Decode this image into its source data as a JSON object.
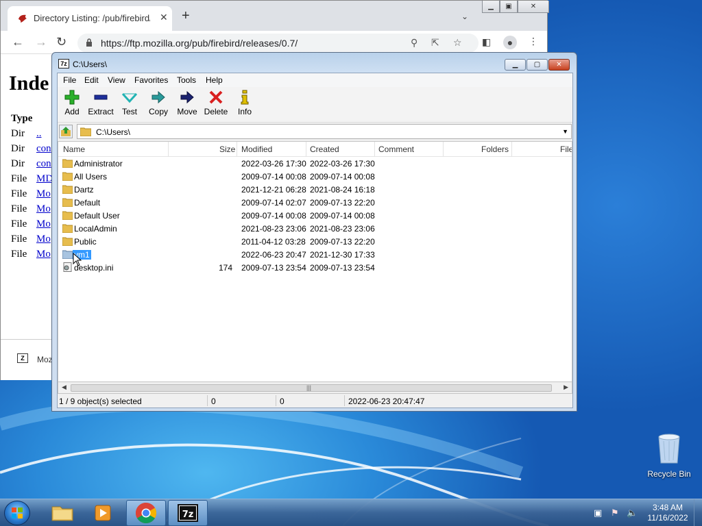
{
  "chrome": {
    "tab_title": "Directory Listing: /pub/firebird/re",
    "url": "https://ftp.mozilla.org/pub/firebird/releases/0.7/",
    "page_heading": "Inde",
    "type_header": "Type",
    "rows": [
      {
        "type": "Dir",
        "link": ".."
      },
      {
        "type": "Dir",
        "link": "con"
      },
      {
        "type": "Dir",
        "link": "con"
      },
      {
        "type": "File",
        "link": "MD"
      },
      {
        "type": "File",
        "link": "Mo"
      },
      {
        "type": "File",
        "link": "Mo"
      },
      {
        "type": "File",
        "link": "Mo"
      },
      {
        "type": "File",
        "link": "Mo"
      },
      {
        "type": "File",
        "link": "Mo"
      }
    ],
    "footer_text": "Moz"
  },
  "sevenzip": {
    "title": "C:\\Users\\",
    "menu": [
      "File",
      "Edit",
      "View",
      "Favorites",
      "Tools",
      "Help"
    ],
    "tools": [
      "Add",
      "Extract",
      "Test",
      "Copy",
      "Move",
      "Delete",
      "Info"
    ],
    "address": "C:\\Users\\",
    "columns": [
      "Name",
      "Size",
      "Modified",
      "Created",
      "Comment",
      "Folders",
      "File"
    ],
    "files": [
      {
        "name": "Administrator",
        "size": "",
        "modified": "2022-03-26 17:30",
        "created": "2022-03-26 17:30",
        "kind": "folder"
      },
      {
        "name": "All Users",
        "size": "",
        "modified": "2009-07-14 00:08",
        "created": "2009-07-14 00:08",
        "kind": "folder"
      },
      {
        "name": "Dartz",
        "size": "",
        "modified": "2021-12-21 06:28",
        "created": "2021-08-24 16:18",
        "kind": "folder"
      },
      {
        "name": "Default",
        "size": "",
        "modified": "2009-07-14 02:07",
        "created": "2009-07-13 22:20",
        "kind": "folder"
      },
      {
        "name": "Default User",
        "size": "",
        "modified": "2009-07-14 00:08",
        "created": "2009-07-14 00:08",
        "kind": "folder"
      },
      {
        "name": "LocalAdmin",
        "size": "",
        "modified": "2021-08-23 23:06",
        "created": "2021-08-23 23:06",
        "kind": "folder"
      },
      {
        "name": "Public",
        "size": "",
        "modified": "2011-04-12 03:28",
        "created": "2009-07-13 22:20",
        "kind": "folder"
      },
      {
        "name": "vm1",
        "size": "",
        "modified": "2022-06-23 20:47",
        "created": "2021-12-30 17:33",
        "kind": "folder-selected"
      },
      {
        "name": "desktop.ini",
        "size": "174",
        "modified": "2009-07-13 23:54",
        "created": "2009-07-13 23:54",
        "kind": "file"
      }
    ],
    "status": {
      "selected": "1 / 9 object(s) selected",
      "size": "0",
      "packed": "0",
      "date": "2022-06-23 20:47:47"
    }
  },
  "desktop": {
    "recycle_label": "Recycle Bin"
  },
  "taskbar": {
    "time": "3:48 AM",
    "date": "11/16/2022"
  },
  "colors": {
    "selection": "#3399ff",
    "link": "#0000cc",
    "add": "#22aa22",
    "extract": "#2233aa",
    "delete": "#dd2222",
    "info": "#ddbb00"
  }
}
